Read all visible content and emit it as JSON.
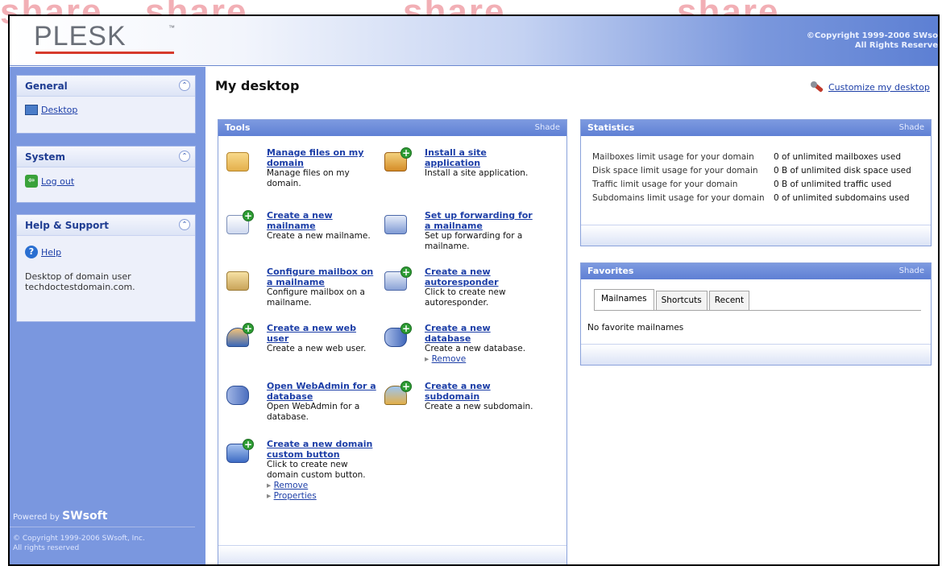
{
  "watermark": [
    "share",
    "share",
    "share",
    "share"
  ],
  "header": {
    "logo": "PLESK",
    "logo_tm": "™",
    "copyright_line1": "©Copyright 1999-2006 SWso",
    "copyright_line2": "All Rights Reserve"
  },
  "sidebar": {
    "general": {
      "title": "General",
      "items": [
        {
          "label": "Desktop",
          "icon": "desktop-icon"
        }
      ]
    },
    "system": {
      "title": "System",
      "items": [
        {
          "label": "Log out",
          "icon": "logout-icon"
        }
      ]
    },
    "help": {
      "title": "Help & Support",
      "items": [
        {
          "label": "Help",
          "icon": "help-icon"
        }
      ],
      "text_line1": "Desktop of domain user",
      "text_line2": "techdoctestdomain.com."
    },
    "collapse_glyph": "⌃",
    "powered_prefix": "Powered by",
    "powered_brand": "SWsoft",
    "copyright_line1": "© Copyright 1999-2006 SWsoft, Inc.",
    "copyright_line2": "All rights reserved"
  },
  "page": {
    "title": "My desktop",
    "customize_label": "Customize my desktop"
  },
  "tools": {
    "title": "Tools",
    "shade": "Shade",
    "items": [
      {
        "link": "Manage files on my domain",
        "desc": "Manage files on my domain.",
        "icon": "folder-files-icon"
      },
      {
        "link": "Install a site application",
        "desc": "Install a site application.",
        "icon": "install-application-icon"
      },
      {
        "link": "Create a new mailname",
        "desc": "Create a new mailname.",
        "icon": "new-mail-icon"
      },
      {
        "link": "Set up forwarding for a mailname",
        "desc": "Set up forwarding for a mailname.",
        "icon": "mail-forward-icon"
      },
      {
        "link": "Configure mailbox on a mailname",
        "desc": "Configure mailbox on a mailname.",
        "icon": "mailbox-icon"
      },
      {
        "link": "Create a new autoresponder",
        "desc": "Click to create new autoresponder.",
        "icon": "autoresponder-icon"
      },
      {
        "link": "Create a new web user",
        "desc": "Create a new web user.",
        "icon": "web-user-icon"
      },
      {
        "link": "Create a new database",
        "desc": "Create a new database.",
        "icon": "database-icon",
        "sub": [
          "Remove"
        ]
      },
      {
        "link": "Open WebAdmin for a database",
        "desc": "Open WebAdmin for a database.",
        "icon": "webadmin-icon"
      },
      {
        "link": "Create a new subdomain",
        "desc": "Create a new subdomain.",
        "icon": "subdomain-icon"
      },
      {
        "link": "Create a new domain custom button",
        "desc": "Click to create new domain custom button.",
        "icon": "custom-button-icon",
        "sub": [
          "Remove",
          "Properties"
        ]
      }
    ]
  },
  "statistics": {
    "title": "Statistics",
    "shade": "Shade",
    "rows": [
      {
        "label": "Mailboxes limit usage for your domain",
        "value": "0 of unlimited mailboxes used"
      },
      {
        "label": "Disk space limit usage for your domain",
        "value": "0 B of unlimited disk space used"
      },
      {
        "label": "Traffic limit usage for your domain",
        "value": "0 B of unlimited traffic used"
      },
      {
        "label": "Subdomains limit usage for your domain",
        "value": "0 of unlimited subdomains used"
      }
    ]
  },
  "favorites": {
    "title": "Favorites",
    "shade": "Shade",
    "tabs": [
      "Mailnames",
      "Shortcuts",
      "Recent"
    ],
    "active_tab": "Mailnames",
    "empty_text": "No favorite mailnames"
  },
  "colors": {
    "accent": "#5f80d4",
    "sidebar_bg": "#7a97df",
    "link": "#1c3ea7",
    "logo_underline": "#d63a2c",
    "watermark": "#e96e7a"
  }
}
